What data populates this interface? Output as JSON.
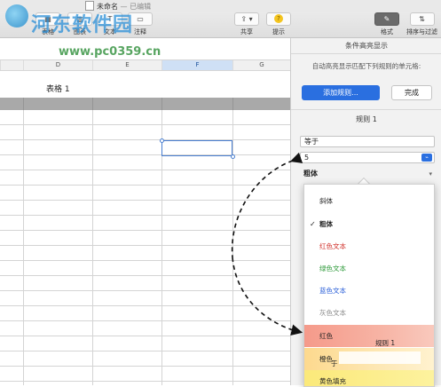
{
  "window": {
    "doc_name": "未命名",
    "doc_status": "— 已编辑"
  },
  "toolbar": {
    "left_buttons": [
      {
        "icon": "table-icon",
        "label": "表格"
      },
      {
        "icon": "chart-icon",
        "label": "图表"
      },
      {
        "icon": "textbox-icon",
        "label": "文本"
      },
      {
        "icon": "comment-icon",
        "label": "注释"
      }
    ],
    "share_label": "共享",
    "tip_label": "提示",
    "format_label": "格式",
    "sort_filter_label": "排序与过滤"
  },
  "sheet": {
    "columns": [
      "D",
      "E",
      "F",
      "G"
    ],
    "selected_column": "F",
    "table_title": "表格 1"
  },
  "panel": {
    "title": "条件高亮显示",
    "description": "自动高亮显示匹配下列规则的单元格:",
    "add_rule_label": "添加规则...",
    "done_label": "完成",
    "rule_title": "规则 1",
    "condition_value": "等于",
    "number_value": "5",
    "style_value": "粗体"
  },
  "dropdown": {
    "options": [
      {
        "label": "斜体",
        "checked": false,
        "color": "#222222"
      },
      {
        "label": "粗体",
        "checked": true,
        "color": "#222222"
      },
      {
        "label": "红色文本",
        "checked": false,
        "color": "#d0302a"
      },
      {
        "label": "绿色文本",
        "checked": false,
        "color": "#2e9a3a"
      },
      {
        "label": "蓝色文本",
        "checked": false,
        "color": "#2a5fd8"
      },
      {
        "label": "灰色文本",
        "checked": false,
        "color": "#8a8a8a"
      },
      {
        "label": "红色",
        "checked": false,
        "color": "#222222"
      },
      {
        "label": "橙色",
        "checked": false,
        "color": "#222222"
      },
      {
        "label": "黄色填充",
        "checked": false,
        "color": "#222222"
      }
    ],
    "overlay_label": "规则 1",
    "overlay_char": "于"
  },
  "watermark": {
    "site_name": "河东软件园",
    "url": "www.pc0359.cn"
  },
  "colors": {
    "accent": "#2a6fe0",
    "selection": "#4a7fd1",
    "red_fill": "#f59a8a",
    "orange_fill": "#fdd98e",
    "yellow_fill": "#fbe97a"
  }
}
